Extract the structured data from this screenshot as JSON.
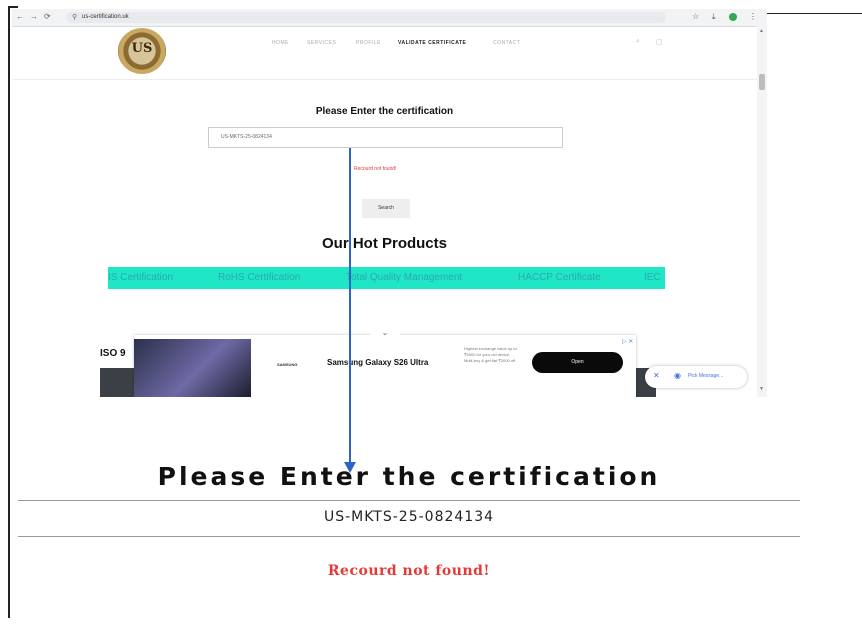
{
  "browser": {
    "url": "us-certification.uk",
    "nav": {
      "back": "←",
      "forward": "→",
      "reload": "⟳"
    },
    "ext_icons": {
      "star": "☆",
      "download": "⤓",
      "menu": "⋮"
    }
  },
  "site": {
    "logo_text": "US",
    "menu": [
      "HOME",
      "SERVICES",
      "PROFILE",
      "VALIDATE CERTIFICATE",
      "CONTACT"
    ],
    "header_icons": {
      "search": "⌕",
      "cart": "▢"
    }
  },
  "form": {
    "title": "Please Enter the certification",
    "input_value": "US-MKTS-25-0824134",
    "error": "Recourd not found!",
    "search_label": "Search"
  },
  "hot_products": {
    "title": "Our Hot Products",
    "items": [
      "IS Certification",
      "RoHS Certification",
      "Total Quality Management",
      "HACCP Certificate",
      "IEC"
    ],
    "band_color": "#1fe7c6"
  },
  "section_label": "ISO 9",
  "ad": {
    "collapse": "⌄",
    "brand": "SAMSUNG",
    "product": "Samsung Galaxy S26 Ultra",
    "desc": "Highest exchange value up to ₹5000 for your old device. Multi-buy & get flat ₹2000 off",
    "cta": "Open",
    "info": "▷ ✕"
  },
  "chat": {
    "close": "✕",
    "icon": "◉",
    "label": "Pick Message..."
  },
  "zoom": {
    "title": "Please Enter the certification",
    "input_value": "US-MKTS-25-0824134",
    "error": "Recourd not found!"
  },
  "colors": {
    "arrow": "#2e63c9",
    "error": "#e53935"
  }
}
